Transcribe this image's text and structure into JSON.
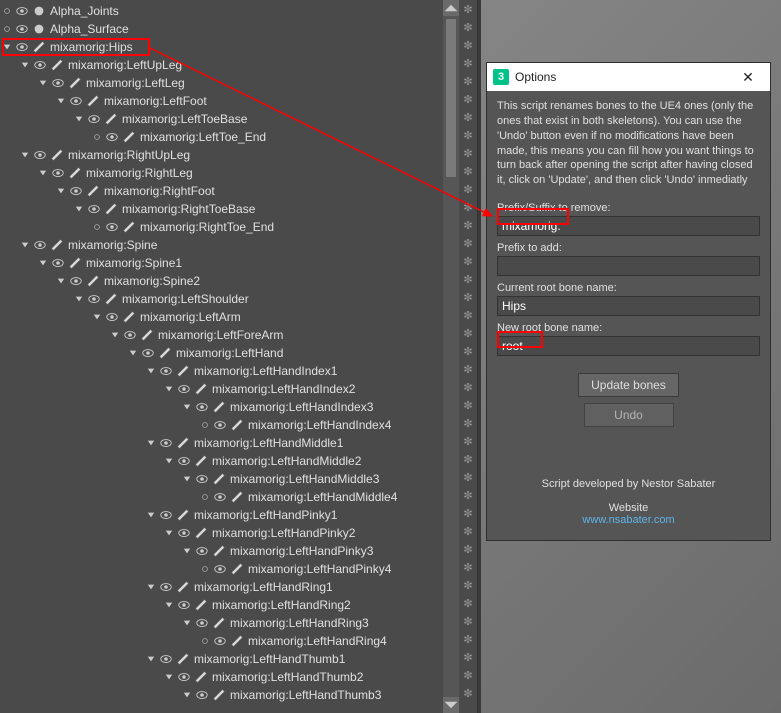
{
  "outliner": {
    "items": [
      {
        "depth": 0,
        "leaf": true,
        "kind": "obj",
        "label": "Alpha_Joints"
      },
      {
        "depth": 0,
        "leaf": true,
        "kind": "obj",
        "label": "Alpha_Surface"
      },
      {
        "depth": 0,
        "leaf": false,
        "kind": "bone",
        "label": "mixamorig:Hips"
      },
      {
        "depth": 1,
        "leaf": false,
        "kind": "bone",
        "label": "mixamorig:LeftUpLeg"
      },
      {
        "depth": 2,
        "leaf": false,
        "kind": "bone",
        "label": "mixamorig:LeftLeg"
      },
      {
        "depth": 3,
        "leaf": false,
        "kind": "bone",
        "label": "mixamorig:LeftFoot"
      },
      {
        "depth": 4,
        "leaf": false,
        "kind": "bone",
        "label": "mixamorig:LeftToeBase"
      },
      {
        "depth": 5,
        "leaf": true,
        "kind": "bone",
        "label": "mixamorig:LeftToe_End"
      },
      {
        "depth": 1,
        "leaf": false,
        "kind": "bone",
        "label": "mixamorig:RightUpLeg"
      },
      {
        "depth": 2,
        "leaf": false,
        "kind": "bone",
        "label": "mixamorig:RightLeg"
      },
      {
        "depth": 3,
        "leaf": false,
        "kind": "bone",
        "label": "mixamorig:RightFoot"
      },
      {
        "depth": 4,
        "leaf": false,
        "kind": "bone",
        "label": "mixamorig:RightToeBase"
      },
      {
        "depth": 5,
        "leaf": true,
        "kind": "bone",
        "label": "mixamorig:RightToe_End"
      },
      {
        "depth": 1,
        "leaf": false,
        "kind": "bone",
        "label": "mixamorig:Spine"
      },
      {
        "depth": 2,
        "leaf": false,
        "kind": "bone",
        "label": "mixamorig:Spine1"
      },
      {
        "depth": 3,
        "leaf": false,
        "kind": "bone",
        "label": "mixamorig:Spine2"
      },
      {
        "depth": 4,
        "leaf": false,
        "kind": "bone",
        "label": "mixamorig:LeftShoulder"
      },
      {
        "depth": 5,
        "leaf": false,
        "kind": "bone",
        "label": "mixamorig:LeftArm"
      },
      {
        "depth": 6,
        "leaf": false,
        "kind": "bone",
        "label": "mixamorig:LeftForeArm"
      },
      {
        "depth": 7,
        "leaf": false,
        "kind": "bone",
        "label": "mixamorig:LeftHand"
      },
      {
        "depth": 8,
        "leaf": false,
        "kind": "bone",
        "label": "mixamorig:LeftHandIndex1"
      },
      {
        "depth": 9,
        "leaf": false,
        "kind": "bone",
        "label": "mixamorig:LeftHandIndex2"
      },
      {
        "depth": 10,
        "leaf": false,
        "kind": "bone",
        "label": "mixamorig:LeftHandIndex3"
      },
      {
        "depth": 11,
        "leaf": true,
        "kind": "bone",
        "label": "mixamorig:LeftHandIndex4"
      },
      {
        "depth": 8,
        "leaf": false,
        "kind": "bone",
        "label": "mixamorig:LeftHandMiddle1"
      },
      {
        "depth": 9,
        "leaf": false,
        "kind": "bone",
        "label": "mixamorig:LeftHandMiddle2"
      },
      {
        "depth": 10,
        "leaf": false,
        "kind": "bone",
        "label": "mixamorig:LeftHandMiddle3"
      },
      {
        "depth": 11,
        "leaf": true,
        "kind": "bone",
        "label": "mixamorig:LeftHandMiddle4"
      },
      {
        "depth": 8,
        "leaf": false,
        "kind": "bone",
        "label": "mixamorig:LeftHandPinky1"
      },
      {
        "depth": 9,
        "leaf": false,
        "kind": "bone",
        "label": "mixamorig:LeftHandPinky2"
      },
      {
        "depth": 10,
        "leaf": false,
        "kind": "bone",
        "label": "mixamorig:LeftHandPinky3"
      },
      {
        "depth": 11,
        "leaf": true,
        "kind": "bone",
        "label": "mixamorig:LeftHandPinky4"
      },
      {
        "depth": 8,
        "leaf": false,
        "kind": "bone",
        "label": "mixamorig:LeftHandRing1"
      },
      {
        "depth": 9,
        "leaf": false,
        "kind": "bone",
        "label": "mixamorig:LeftHandRing2"
      },
      {
        "depth": 10,
        "leaf": false,
        "kind": "bone",
        "label": "mixamorig:LeftHandRing3"
      },
      {
        "depth": 11,
        "leaf": true,
        "kind": "bone",
        "label": "mixamorig:LeftHandRing4"
      },
      {
        "depth": 8,
        "leaf": false,
        "kind": "bone",
        "label": "mixamorig:LeftHandThumb1"
      },
      {
        "depth": 9,
        "leaf": false,
        "kind": "bone",
        "label": "mixamorig:LeftHandThumb2"
      },
      {
        "depth": 10,
        "leaf": false,
        "kind": "bone",
        "label": "mixamorig:LeftHandThumb3"
      }
    ]
  },
  "dialog": {
    "title": "Options",
    "description": "This script renames bones to the UE4 ones (only the ones that exist in both skeletons). You can use the 'Undo' button even if no modifications have been made, this means you can fill how you want things to turn back after opening the script after having closed it, click on 'Update', and then click 'Undo' inmediatly",
    "fields": {
      "prefix_remove_label": "Prefix/Suffix to remove:",
      "prefix_remove_value": "mixamorig:",
      "prefix_add_label": "Prefix to add:",
      "prefix_add_value": "",
      "current_root_label": "Current root bone name:",
      "current_root_value": "Hips",
      "new_root_label": "New root bone name:",
      "new_root_value": "root"
    },
    "buttons": {
      "update": "Update bones",
      "undo": "Undo"
    },
    "credit_line": "Script developed by Nestor Sabater",
    "website_label": "Website",
    "website_url": "www.nsabater.com"
  }
}
